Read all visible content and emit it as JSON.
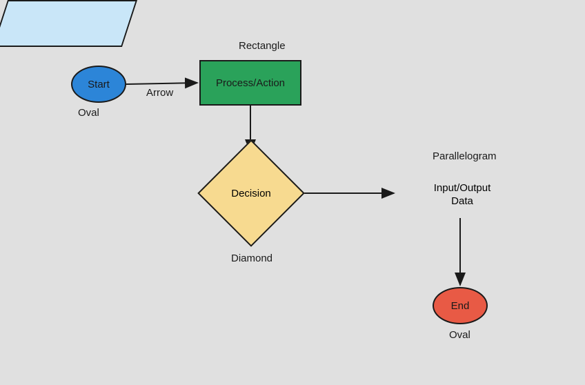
{
  "nodes": {
    "start": {
      "text": "Start",
      "label": "Oval"
    },
    "process": {
      "text": "Process/Action",
      "label": "Rectangle"
    },
    "decision": {
      "text": "Decision",
      "label": "Diamond"
    },
    "io": {
      "text": "Input/Output\nData",
      "label": "Parallelogram"
    },
    "end": {
      "text": "End",
      "label": "Oval"
    }
  },
  "edges": {
    "start_to_process": {
      "label": "Arrow"
    }
  }
}
